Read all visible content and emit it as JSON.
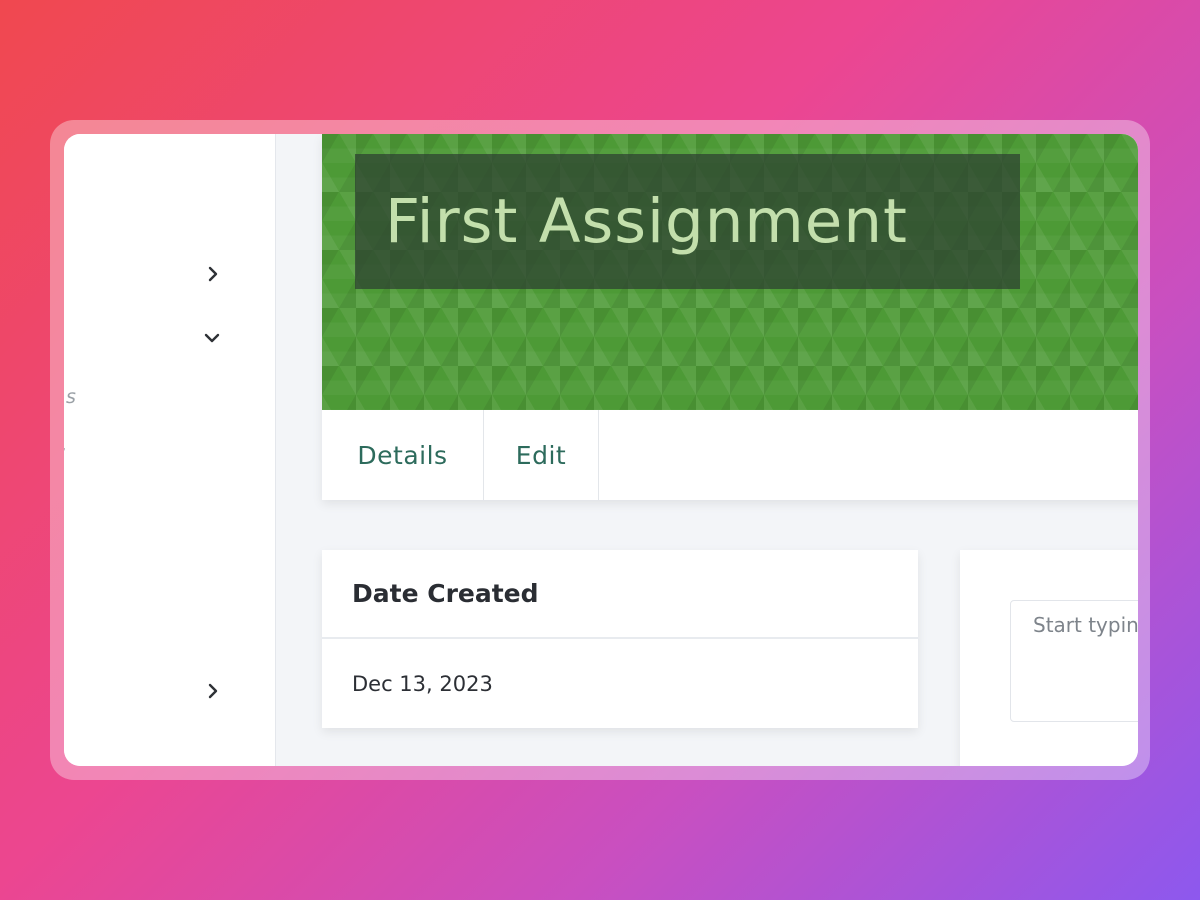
{
  "assignment": {
    "title": "First Assignment"
  },
  "tabs": [
    {
      "label": "Details"
    },
    {
      "label": "Edit"
    }
  ],
  "sidebar": {
    "fragments": [
      "s",
      ":"
    ]
  },
  "date_card": {
    "heading": "Date Created",
    "value": "Dec 13, 2023"
  },
  "editor": {
    "placeholder": "Start typing..."
  },
  "colors": {
    "banner": "#4d9a36",
    "title_text": "#c3dfac",
    "tab_text": "#2d6b5c"
  }
}
